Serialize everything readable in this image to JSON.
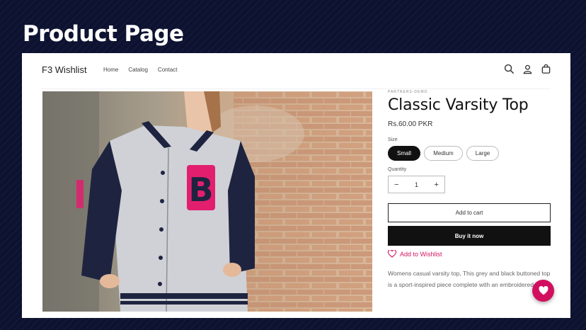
{
  "banner": {
    "title": "Product Page"
  },
  "header": {
    "store_name": "F3 Wishlist",
    "nav": [
      {
        "label": "Home"
      },
      {
        "label": "Catalog"
      },
      {
        "label": "Contact"
      }
    ],
    "icons": [
      "search-icon",
      "account-icon",
      "cart-icon"
    ]
  },
  "product": {
    "vendor": "PARTNERS-DEMO",
    "title": "Classic Varsity Top",
    "price": "Rs.60.00 PKR",
    "size_label": "Size",
    "sizes": [
      {
        "label": "Small",
        "selected": true
      },
      {
        "label": "Medium",
        "selected": false
      },
      {
        "label": "Large",
        "selected": false
      }
    ],
    "quantity_label": "Quantity",
    "quantity": "1",
    "add_to_cart": "Add to cart",
    "buy_now": "Buy it now",
    "wishlist_label": "Add to Wishlist",
    "description": "Womens casual varsity top, This grey and black buttoned top is a sport-inspired piece complete with an embroidered letter."
  },
  "colors": {
    "accent": "#d10f5e",
    "banner_bg": "#0c1230",
    "button_dark": "#111111"
  }
}
